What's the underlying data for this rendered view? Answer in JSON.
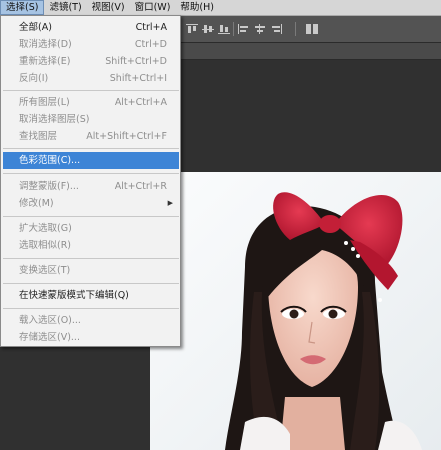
{
  "menubar": {
    "items": [
      {
        "label": "选择(S)"
      },
      {
        "label": "滤镜(T)"
      },
      {
        "label": "视图(V)"
      },
      {
        "label": "窗口(W)"
      },
      {
        "label": "帮助(H)"
      }
    ]
  },
  "select_menu": {
    "items": [
      {
        "label": "全部(A)",
        "shortcut": "Ctrl+A"
      },
      {
        "label": "取消选择(D)",
        "shortcut": "Ctrl+D"
      },
      {
        "label": "重新选择(E)",
        "shortcut": "Shift+Ctrl+D"
      },
      {
        "label": "反向(I)",
        "shortcut": "Shift+Ctrl+I"
      },
      {
        "label": "所有图层(L)",
        "shortcut": "Alt+Ctrl+A"
      },
      {
        "label": "取消选择图层(S)",
        "shortcut": ""
      },
      {
        "label": "查找图层",
        "shortcut": "Alt+Shift+Ctrl+F"
      },
      {
        "label": "色彩范围(C)...",
        "shortcut": ""
      },
      {
        "label": "调整蒙版(F)...",
        "shortcut": "Alt+Ctrl+R"
      },
      {
        "label": "修改(M)",
        "shortcut": ""
      },
      {
        "label": "扩大选取(G)",
        "shortcut": ""
      },
      {
        "label": "选取相似(R)",
        "shortcut": ""
      },
      {
        "label": "变换选区(T)",
        "shortcut": ""
      },
      {
        "label": "在快速蒙版模式下编辑(Q)",
        "shortcut": ""
      },
      {
        "label": "载入选区(O)...",
        "shortcut": ""
      },
      {
        "label": "存储选区(V)...",
        "shortcut": ""
      }
    ]
  },
  "colors": {
    "menubar_bg": "#d6d6d6",
    "menu_bg": "#f2f2f2",
    "menu_highlight": "#3d84d6",
    "workspace_bg": "#303030",
    "options_bar_bg": "#535353",
    "bow_red": "#d21f3c"
  }
}
